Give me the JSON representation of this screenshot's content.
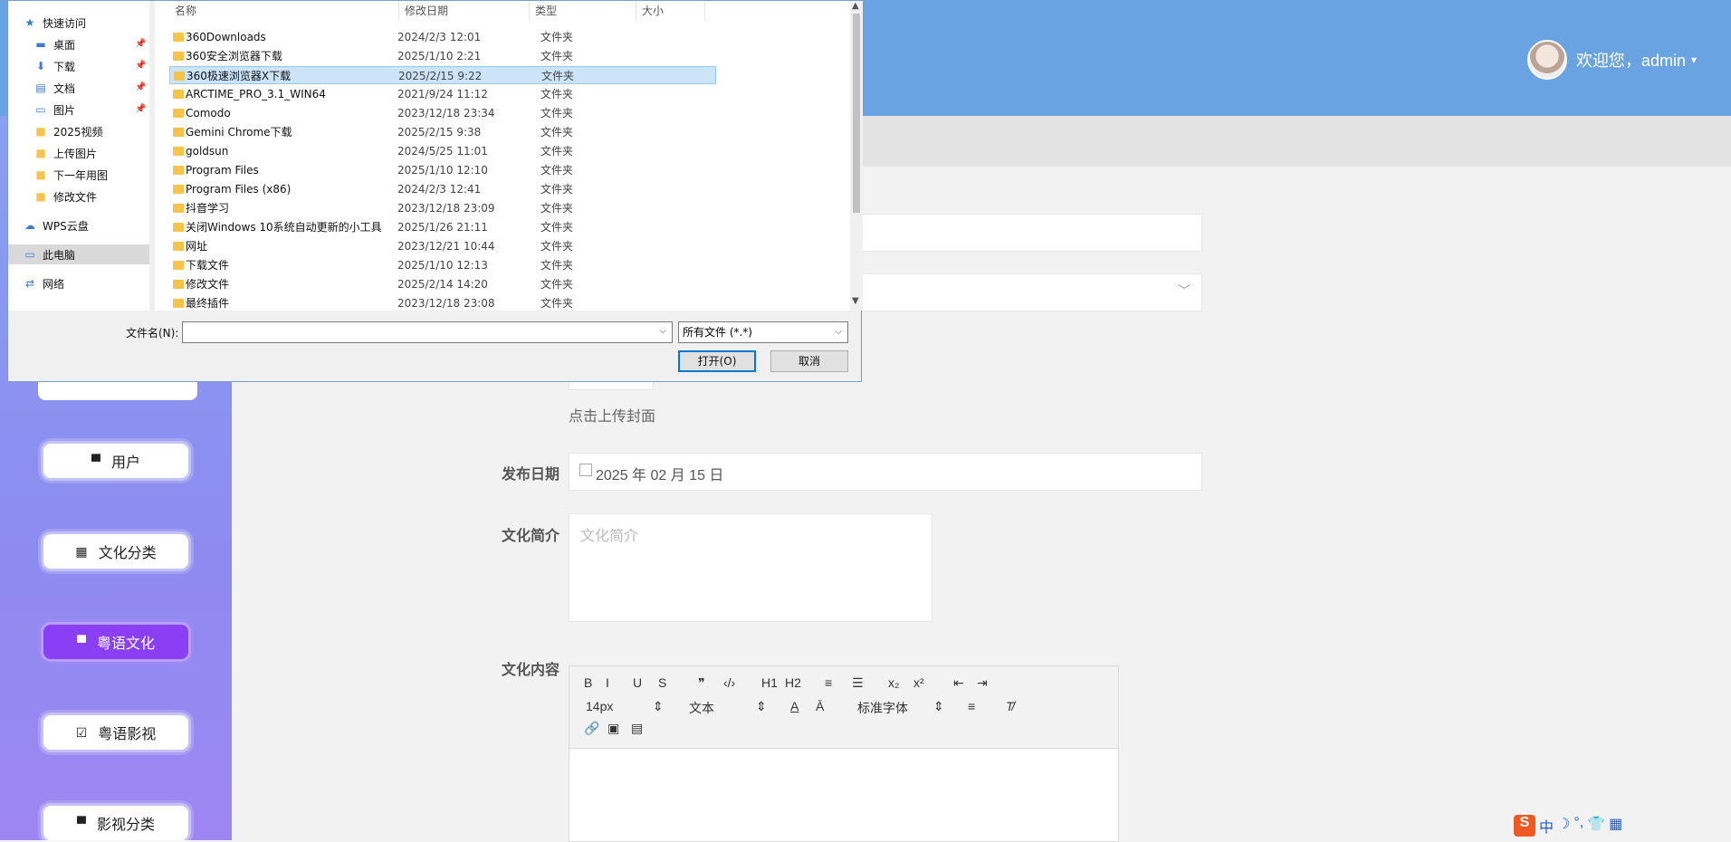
{
  "header": {
    "greeting": "欢迎您，admin",
    "caret": "▾"
  },
  "sidebar": {
    "items": [
      {
        "label": "用户",
        "icon": "▀",
        "active": false
      },
      {
        "label": "文化分类",
        "icon": "▦",
        "active": false
      },
      {
        "label": "粤语文化",
        "icon": "▀",
        "active": true
      },
      {
        "label": "粤语影视",
        "icon": "☑",
        "active": false
      },
      {
        "label": "影视分类",
        "icon": "▀",
        "active": false
      }
    ]
  },
  "form": {
    "upload_hint": "点击上传封面",
    "date_label": "发布日期",
    "date_value": "2025 年 02 月 15 日",
    "intro_label": "文化简介",
    "intro_placeholder": "文化简介",
    "content_label": "文化内容",
    "select_caret": "﹀"
  },
  "editor": {
    "row1": [
      "B",
      "I",
      "U",
      "S",
      "❞",
      "‹/›",
      "H1",
      "H2",
      "≡",
      "☰",
      "x₂",
      "x²",
      "⇤",
      "⇥"
    ],
    "font_size": "14px",
    "text_type": "文本",
    "font_family": "标准字体",
    "spin": "⇕"
  },
  "ime": {
    "logo": "S",
    "lang": "中",
    "items": [
      "☽",
      "°,",
      "👕",
      "▦"
    ]
  },
  "dialog": {
    "nav": [
      {
        "label": "快速访问",
        "glyph": "★",
        "pinned": false
      },
      {
        "label": "桌面",
        "glyph": "▬",
        "pinned": true
      },
      {
        "label": "下载",
        "glyph": "⬇",
        "pinned": true
      },
      {
        "label": "文档",
        "glyph": "▤",
        "pinned": true
      },
      {
        "label": "图片",
        "glyph": "▭",
        "pinned": true
      },
      {
        "label": "2025视频",
        "glyph": "■",
        "pinned": false
      },
      {
        "label": "上传图片",
        "glyph": "■",
        "pinned": false
      },
      {
        "label": "下一年用图",
        "glyph": "■",
        "pinned": false
      },
      {
        "label": "修改文件",
        "glyph": "■",
        "pinned": false
      },
      {
        "label": "WPS云盘",
        "glyph": "☁",
        "pinned": false
      },
      {
        "label": "此电脑",
        "glyph": "▭",
        "pinned": false
      },
      {
        "label": "网络",
        "glyph": "⇄",
        "pinned": false
      }
    ],
    "pin_glyph": "📌",
    "columns": [
      "名称",
      "修改日期",
      "类型",
      "大小"
    ],
    "files": [
      {
        "name": "360Downloads",
        "date": "2024/2/3 12:01",
        "type": "文件夹"
      },
      {
        "name": "360安全浏览器下载",
        "date": "2025/1/10 2:21",
        "type": "文件夹"
      },
      {
        "name": "360极速浏览器X下载",
        "date": "2025/2/15 9:22",
        "type": "文件夹"
      },
      {
        "name": "ARCTIME_PRO_3.1_WIN64",
        "date": "2021/9/24 11:12",
        "type": "文件夹"
      },
      {
        "name": "Comodo",
        "date": "2023/12/18 23:34",
        "type": "文件夹"
      },
      {
        "name": "Gemini Chrome下载",
        "date": "2025/2/15 9:38",
        "type": "文件夹"
      },
      {
        "name": "goldsun",
        "date": "2024/5/25 11:01",
        "type": "文件夹"
      },
      {
        "name": "Program Files",
        "date": "2025/1/10 12:10",
        "type": "文件夹"
      },
      {
        "name": "Program Files (x86)",
        "date": "2024/2/3 12:41",
        "type": "文件夹"
      },
      {
        "name": "抖音学习",
        "date": "2023/12/18 23:09",
        "type": "文件夹"
      },
      {
        "name": "关闭Windows 10系统自动更新的小工具",
        "date": "2025/1/26 21:11",
        "type": "文件夹"
      },
      {
        "name": "网址",
        "date": "2023/12/21 10:44",
        "type": "文件夹"
      },
      {
        "name": "下载文件",
        "date": "2025/1/10 12:13",
        "type": "文件夹"
      },
      {
        "name": "修改文件",
        "date": "2025/2/14 14:20",
        "type": "文件夹"
      },
      {
        "name": "最终插件",
        "date": "2023/12/18 23:08",
        "type": "文件夹"
      }
    ],
    "filename_label": "文件名(N):",
    "filename_value": "",
    "filter": "所有文件 (*.*)",
    "open_label": "打开(O)",
    "cancel_label": "取消",
    "scroll_up": "▲",
    "scroll_down": "▼",
    "dropdown_glyph": "⌵"
  }
}
